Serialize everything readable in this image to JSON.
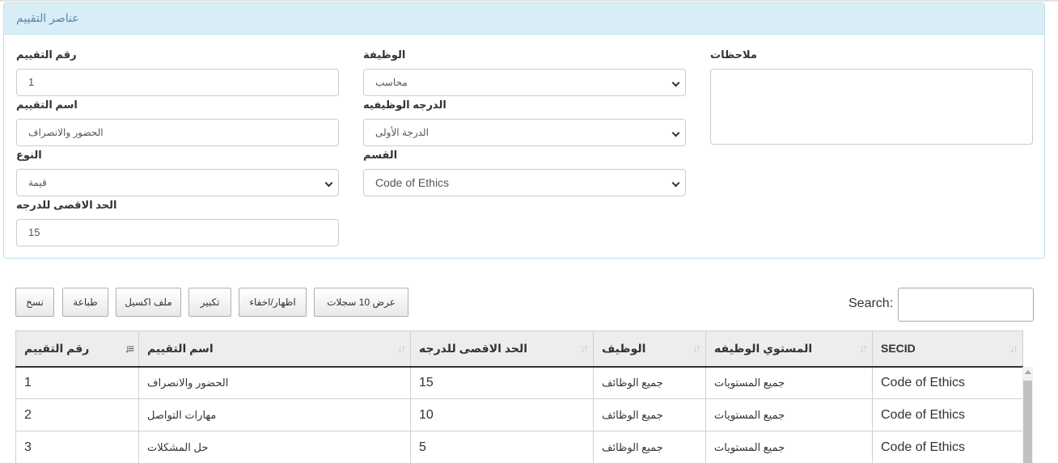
{
  "panel": {
    "title": "عناصر التقييم"
  },
  "form": {
    "eval_number": {
      "label": "رقم التقييم",
      "value": "1"
    },
    "job": {
      "label": "الوظيفة",
      "value": "محاسب"
    },
    "notes": {
      "label": "ملاحظات",
      "value": ""
    },
    "eval_name": {
      "label": "اسم التقييم",
      "value": "الحضور والانصراف"
    },
    "job_grade": {
      "label": "الدرجه الوظيفيه",
      "value": "الدرجة الأولى"
    },
    "type": {
      "label": "النوع",
      "value": "قيمة"
    },
    "section": {
      "label": "القسم",
      "value": "Code of Ethics"
    },
    "max_grade": {
      "label": "الحد الاقصى للدرجه",
      "value": "15"
    }
  },
  "toolbar": {
    "copy": "نسخ",
    "print": "طباعة",
    "excel": "ملف اكسيل",
    "zoom": "تكبير",
    "show_hide": "اظهار/اخفاء",
    "show_records": "عرض 10 سجلات"
  },
  "search": {
    "label": "Search:",
    "value": ""
  },
  "table": {
    "headers": [
      "رقم التقييم",
      "اسم التقييم",
      "الحد الاقصى للدرجه",
      "الوظيف",
      "المستوي الوظيفه",
      "SECID"
    ],
    "rows": [
      [
        "1",
        "الحضور والانصراف",
        "15",
        "جميع الوظائف",
        "جميع المستويات",
        "Code of Ethics"
      ],
      [
        "2",
        "مهارات التواصل",
        "10",
        "جميع الوظائف",
        "جميع المستويات",
        "Code of Ethics"
      ],
      [
        "3",
        "حل المشكلات",
        "5",
        "جميع الوظائف",
        "جميع المستويات",
        "Code of Ethics"
      ]
    ]
  },
  "icons": {
    "sort": "sort-arrows-icon",
    "sort_active": "sort-asc-icon",
    "select": "chevron-down-icon"
  }
}
